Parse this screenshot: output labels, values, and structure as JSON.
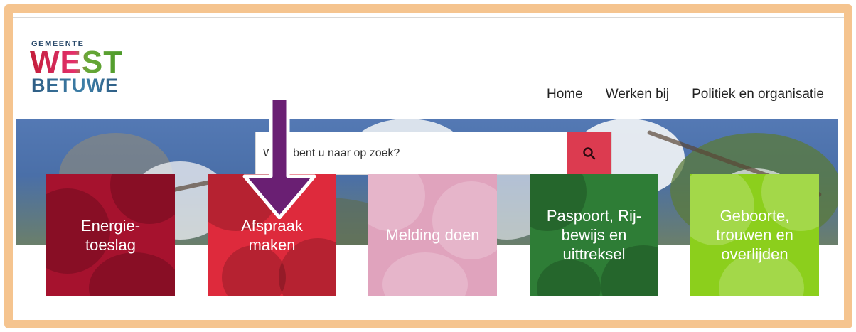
{
  "logo": {
    "line1": "GEMEENTE",
    "line2": "WEST",
    "line3": "BETUWE"
  },
  "nav": {
    "items": [
      "Home",
      "Werken bij",
      "Politiek en organisatie"
    ]
  },
  "search": {
    "placeholder": "Waar bent u naar op zoek?",
    "button_icon": "search-icon",
    "button_color": "#dc3b50"
  },
  "tiles": [
    {
      "label": "Energie-\ntoeslag",
      "color": "#a6122e"
    },
    {
      "label": "Afspraak\nmaken",
      "color": "#de2a3c"
    },
    {
      "label": "Melding doen",
      "color": "#e0a3bd"
    },
    {
      "label": "Paspoort, Rij-\nbewijs en\nuittreksel",
      "color": "#2e7d36"
    },
    {
      "label": "Geboorte,\ntrouwen en\noverlijden",
      "color": "#8ccf1c"
    }
  ],
  "annotation": {
    "arrow_color": "#6a1f73",
    "frame_color": "#f5c48f"
  }
}
